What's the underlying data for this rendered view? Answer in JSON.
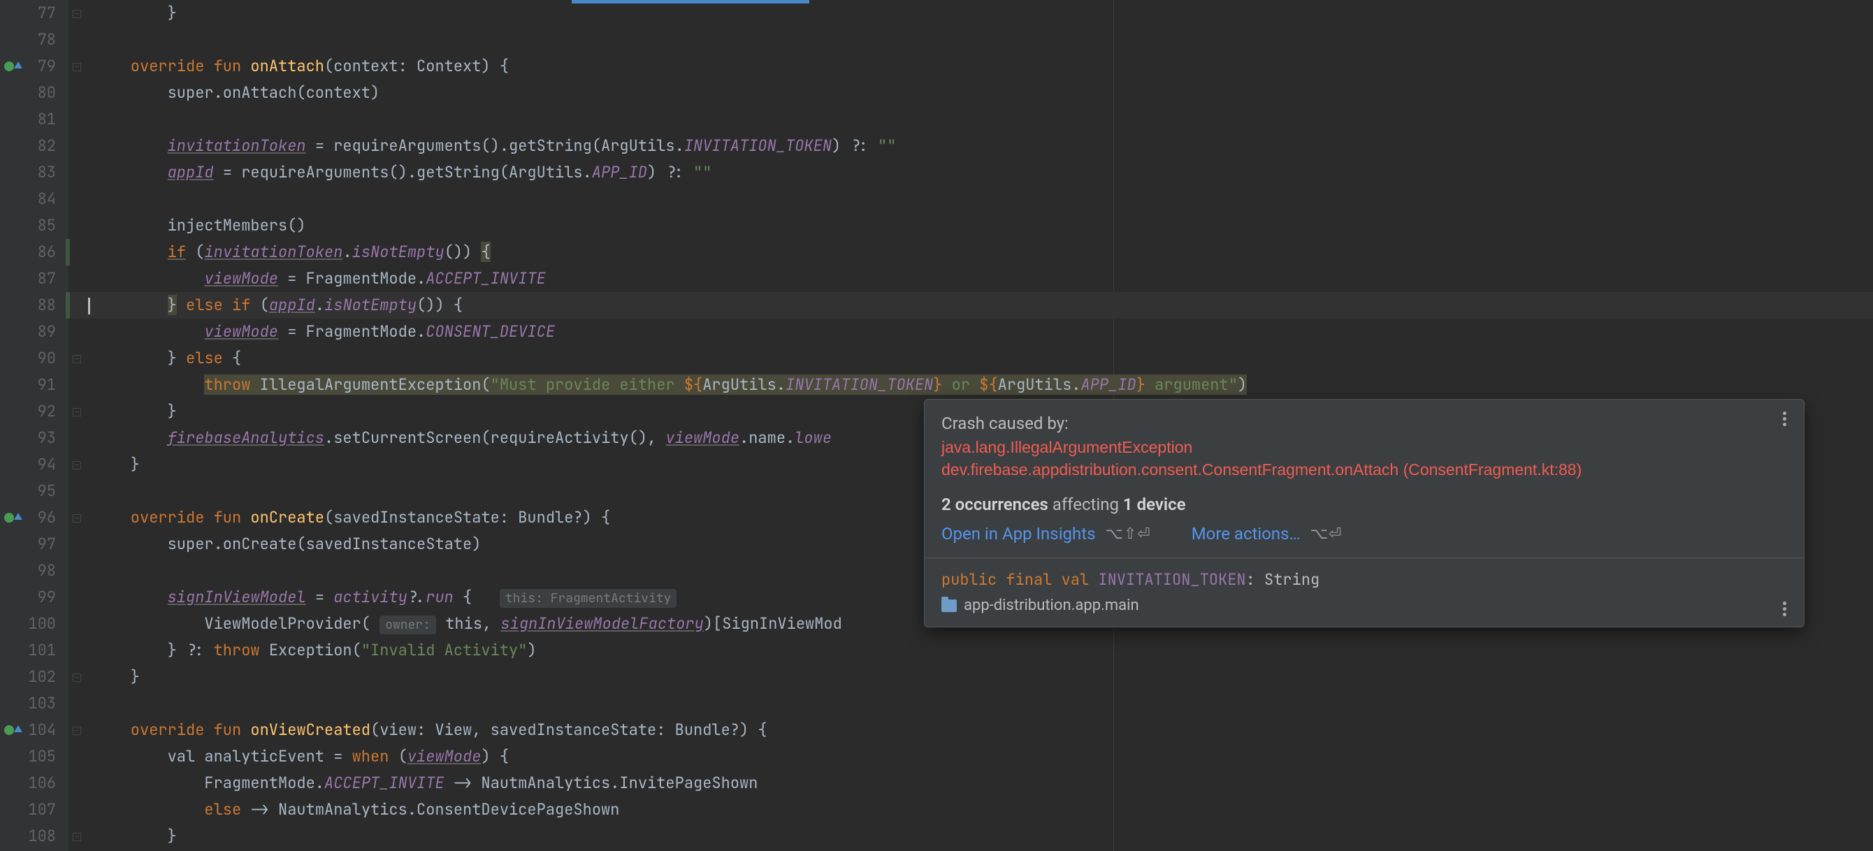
{
  "lines": [
    {
      "n": 77
    },
    {
      "n": 78
    },
    {
      "n": 79,
      "mark": "override"
    },
    {
      "n": 80
    },
    {
      "n": 81
    },
    {
      "n": 82
    },
    {
      "n": 83
    },
    {
      "n": 84
    },
    {
      "n": 85
    },
    {
      "n": 86
    },
    {
      "n": 87
    },
    {
      "n": 88,
      "current": true
    },
    {
      "n": 89
    },
    {
      "n": 90
    },
    {
      "n": 91
    },
    {
      "n": 92
    },
    {
      "n": 93
    },
    {
      "n": 94
    },
    {
      "n": 95
    },
    {
      "n": 96,
      "mark": "override"
    },
    {
      "n": 97
    },
    {
      "n": 98
    },
    {
      "n": 99
    },
    {
      "n": 100
    },
    {
      "n": 101
    },
    {
      "n": 102
    },
    {
      "n": 103
    },
    {
      "n": 104,
      "mark": "override"
    },
    {
      "n": 105
    },
    {
      "n": 106
    },
    {
      "n": 107
    },
    {
      "n": 108
    }
  ],
  "code": {
    "l77": "        }",
    "l79a": "    override fun ",
    "l79b": "onAttach",
    "l79c": "(context: Context) {",
    "l80": "        super.onAttach(context)",
    "l82a": "        ",
    "l82b": "invitationToken",
    "l82c": " = requireArguments().getString(ArgUtils.",
    "l82d": "INVITATION_TOKEN",
    "l82e": ") ?: ",
    "l82f": "\"\"",
    "l83a": "        ",
    "l83b": "appId",
    "l83c": " = requireArguments().getString(ArgUtils.",
    "l83d": "APP_ID",
    "l83e": ") ?: ",
    "l83f": "\"\"",
    "l85": "        injectMembers()",
    "l86a": "        ",
    "l86b": "if",
    "l86c": " (",
    "l86d": "invitationToken",
    "l86e": ".",
    "l86f": "isNotEmpty",
    "l86g": "()) ",
    "l86h": "{",
    "l87a": "            ",
    "l87b": "viewMode",
    "l87c": " = FragmentMode.",
    "l87d": "ACCEPT_INVITE",
    "l88a": "        ",
    "l88b": "}",
    "l88c": " else if ",
    "l88d": "(",
    "l88e": "appId",
    "l88f": ".",
    "l88g": "isNotEmpty",
    "l88h": "()) {",
    "l89a": "            ",
    "l89b": "viewMode",
    "l89c": " = FragmentMode.",
    "l89d": "CONSENT_DEVICE",
    "l90a": "        } ",
    "l90b": "else",
    "l90c": " {",
    "l91a": "            ",
    "l91b": "throw",
    "l91c": " IllegalArgumentException(",
    "l91d": "\"Must provide either ",
    "l91e": "${",
    "l91f": "ArgUtils.",
    "l91g": "INVITATION_TOKEN",
    "l91h": "}",
    "l91i": " or ",
    "l91j": "${",
    "l91k": "ArgUtils.",
    "l91l": "APP_ID",
    "l91m": "}",
    "l91n": " argument\"",
    "l91o": ")",
    "l92": "        }",
    "l93a": "        ",
    "l93b": "firebaseAnalytics",
    "l93c": ".setCurrentScreen(requireActivity(), ",
    "l93d": "viewMode",
    "l93e": ".name.",
    "l93f": "lowe",
    "l94": "    }",
    "l96a": "    override fun ",
    "l96b": "onCreate",
    "l96c": "(savedInstanceState: Bundle?) {",
    "l97": "        super.onCreate(savedInstanceState)",
    "l99a": "        ",
    "l99b": "signInViewModel",
    "l99c": " = ",
    "l99d": "activity",
    "l99e": "?.",
    "l99f": "run",
    "l99g": " {",
    "l99hint": "this: FragmentActivity",
    "l100a": "            ViewModelProvider( ",
    "l100hint": "owner:",
    "l100b": " this, ",
    "l100c": "signInViewModelFactory",
    "l100d": ")[SignInViewMod",
    "l101a": "        } ?: ",
    "l101b": "throw",
    "l101c": " Exception(",
    "l101d": "\"Invalid Activity\"",
    "l101e": ")",
    "l102": "    }",
    "l104a": "    override fun ",
    "l104b": "onViewCreated",
    "l104c": "(view: View, savedInstanceState: Bundle?) {",
    "l105a": "        val analyticEvent = ",
    "l105b": "when",
    "l105c": " (",
    "l105d": "viewMode",
    "l105e": ") {",
    "l106a": "            FragmentMode.",
    "l106b": "ACCEPT_INVITE",
    "l106c": " -> NautmAnalytics.InvitePageShown",
    "l107a": "            ",
    "l107b": "else",
    "l107c": " -> NautmAnalytics.ConsentDevicePageShown",
    "l108": "        }"
  },
  "popup": {
    "title": "Crash caused by:",
    "exception": "java.lang.IllegalArgumentException",
    "location": "dev.firebase.appdistribution.consent.ConsentFragment.onAttach (ConsentFragment.kt:88)",
    "occurrences_count": "2 occurrences",
    "affecting_text": " affecting ",
    "devices_count": "1 device",
    "open_link": "Open in App Insights",
    "open_shortcut": "⌥⇧⏎",
    "more_link": "More actions…",
    "more_shortcut": "⌥⏎",
    "sig_mod": "public  final  val  ",
    "sig_name": "INVITATION_TOKEN",
    "sig_sep": ": ",
    "sig_type": "String",
    "module": "app-distribution.app.main"
  }
}
